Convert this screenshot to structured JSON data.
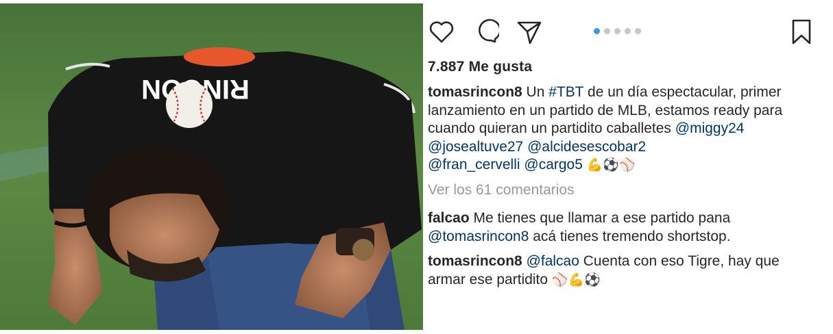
{
  "post": {
    "image_alt": "",
    "actions": {
      "like_icon": "heart-icon",
      "comment_icon": "comment-icon",
      "share_icon": "send-icon",
      "save_icon": "bookmark-icon"
    },
    "carousel": {
      "count": 5,
      "active_index": 0,
      "active_color": "#3897f0",
      "inactive_color": "#c7c7c7"
    },
    "likes": "7.887 Me gusta",
    "caption": {
      "username": "tomasrincon8",
      "text_1": " Un ",
      "hashtag": "#TBT",
      "text_2": " de un día espectacular, primer lanzamiento en un partido de MLB, estamos ready para cuando quieran un partidito caballetes ",
      "mentions": [
        "@miggy24",
        "@josealtuve27",
        "@alcidesescobar2",
        "@fran_cervelli",
        "@cargo5"
      ],
      "emojis": "💪⚽⚾"
    },
    "view_comments": "Ver los 61 comentarios",
    "comments": [
      {
        "username": "falcao",
        "text_1": " Me tienes que llamar a ese partido pana ",
        "mention": "@tomasrincon8",
        "text_2": " acá tienes tremendo shortstop."
      },
      {
        "username": "tomasrincon8",
        "mention": "@falcao",
        "text_1": " Cuenta con eso Tigre, hay que armar ese partidito ",
        "emojis": "⚾💪⚽"
      }
    ],
    "jersey_name": "RINCON"
  }
}
